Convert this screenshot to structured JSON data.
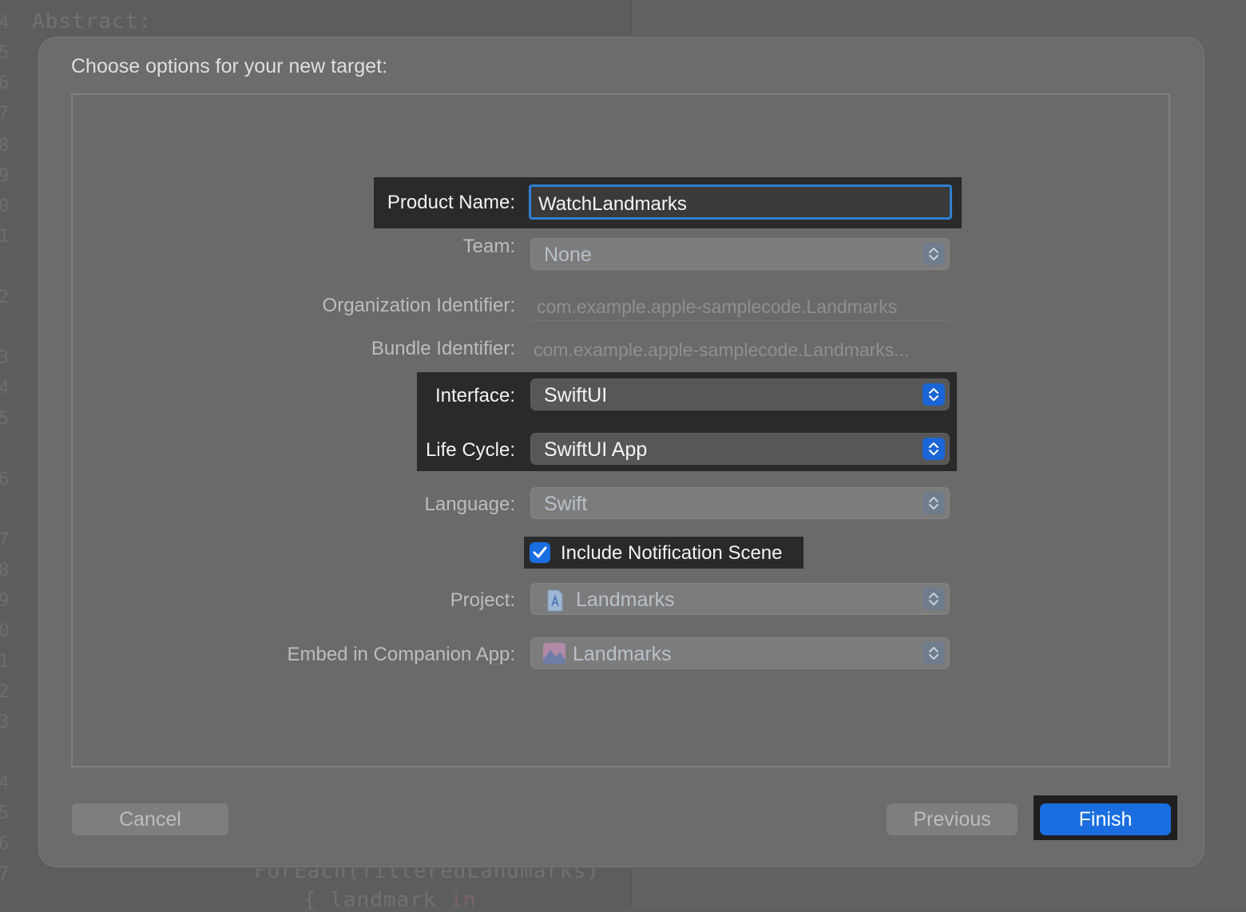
{
  "background_editor": {
    "top_code": "Abstract:",
    "bottom_code_line1": "ForEach(filteredLandmarks)",
    "bottom_code_line2_text": "{ landmark ",
    "bottom_code_line2_keyword": "in",
    "gutter_numbers": [
      "4",
      "5",
      "6",
      "7",
      "8",
      "9",
      "0",
      "1",
      "2",
      "3",
      "4",
      "5",
      "6",
      "7",
      "8",
      "9",
      "0",
      "1",
      "2",
      "3",
      "4",
      "5",
      "6",
      "7"
    ]
  },
  "sheet": {
    "title": "Choose options for your new target:"
  },
  "form": {
    "product_name": {
      "label": "Product Name:",
      "value": "WatchLandmarks"
    },
    "team": {
      "label": "Team:",
      "value": "None"
    },
    "organization_identifier": {
      "label": "Organization Identifier:",
      "value": "com.example.apple-samplecode.Landmarks"
    },
    "bundle_identifier": {
      "label": "Bundle Identifier:",
      "value": "com.example.apple-samplecode.Landmarks..."
    },
    "interface": {
      "label": "Interface:",
      "value": "SwiftUI"
    },
    "life_cycle": {
      "label": "Life Cycle:",
      "value": "SwiftUI App"
    },
    "language": {
      "label": "Language:",
      "value": "Swift"
    },
    "include_notification_scene": {
      "label": "Include Notification Scene",
      "checked": true
    },
    "project": {
      "label": "Project:",
      "value": "Landmarks",
      "icon": "xcode-project-icon"
    },
    "embed_in_companion_app": {
      "label": "Embed in Companion App:",
      "value": "Landmarks",
      "icon": "app-icon"
    }
  },
  "buttons": {
    "cancel": "Cancel",
    "previous": "Previous",
    "finish": "Finish"
  },
  "colors": {
    "accent": "#1a6ee0",
    "focus_ring": "#2f7fd1",
    "sheet_background": "#6c6c6c"
  }
}
